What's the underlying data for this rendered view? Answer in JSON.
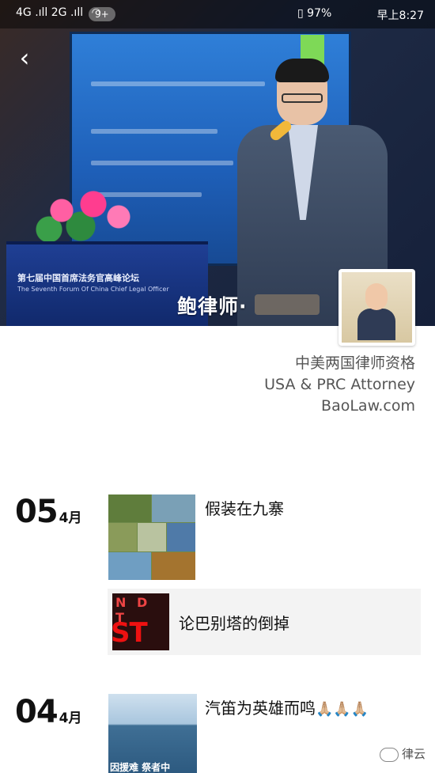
{
  "status_bar": {
    "signal": "4G .ıll 2G .ıll",
    "notifications_badge": "9+",
    "battery": "97%",
    "time": "早上8:27"
  },
  "cover": {
    "podium_title": "第七届中国首席法务官高峰论坛",
    "podium_subtitle": "The Seventh Forum Of China Chief Legal Officer",
    "caption": "鲍律师·"
  },
  "profile": {
    "line1": "中美两国律师资格",
    "line2": "USA & PRC Attorney",
    "line3": "BaoLaw.com"
  },
  "feed": [
    {
      "day": "05",
      "month": "4月",
      "posts": [
        {
          "type": "photo_grid",
          "text": "假装在九寨"
        },
        {
          "type": "share",
          "thumb_top": "N D T",
          "thumb_bottom": "ST MA",
          "text": "论巴别塔的倒掉"
        }
      ]
    },
    {
      "day": "04",
      "month": "4月",
      "posts": [
        {
          "type": "photo",
          "text": "汽笛为英雄而鸣",
          "emoji": "🙏🏼🙏🏼🙏🏼",
          "thumb_overlay": "因援难  祭者中"
        }
      ]
    }
  ],
  "watermark": {
    "text": "律云"
  },
  "icons": {
    "back": "chevron-left-icon",
    "wifi": "wifi-icon",
    "battery": "battery-icon",
    "watermark": "wechat-icon"
  }
}
